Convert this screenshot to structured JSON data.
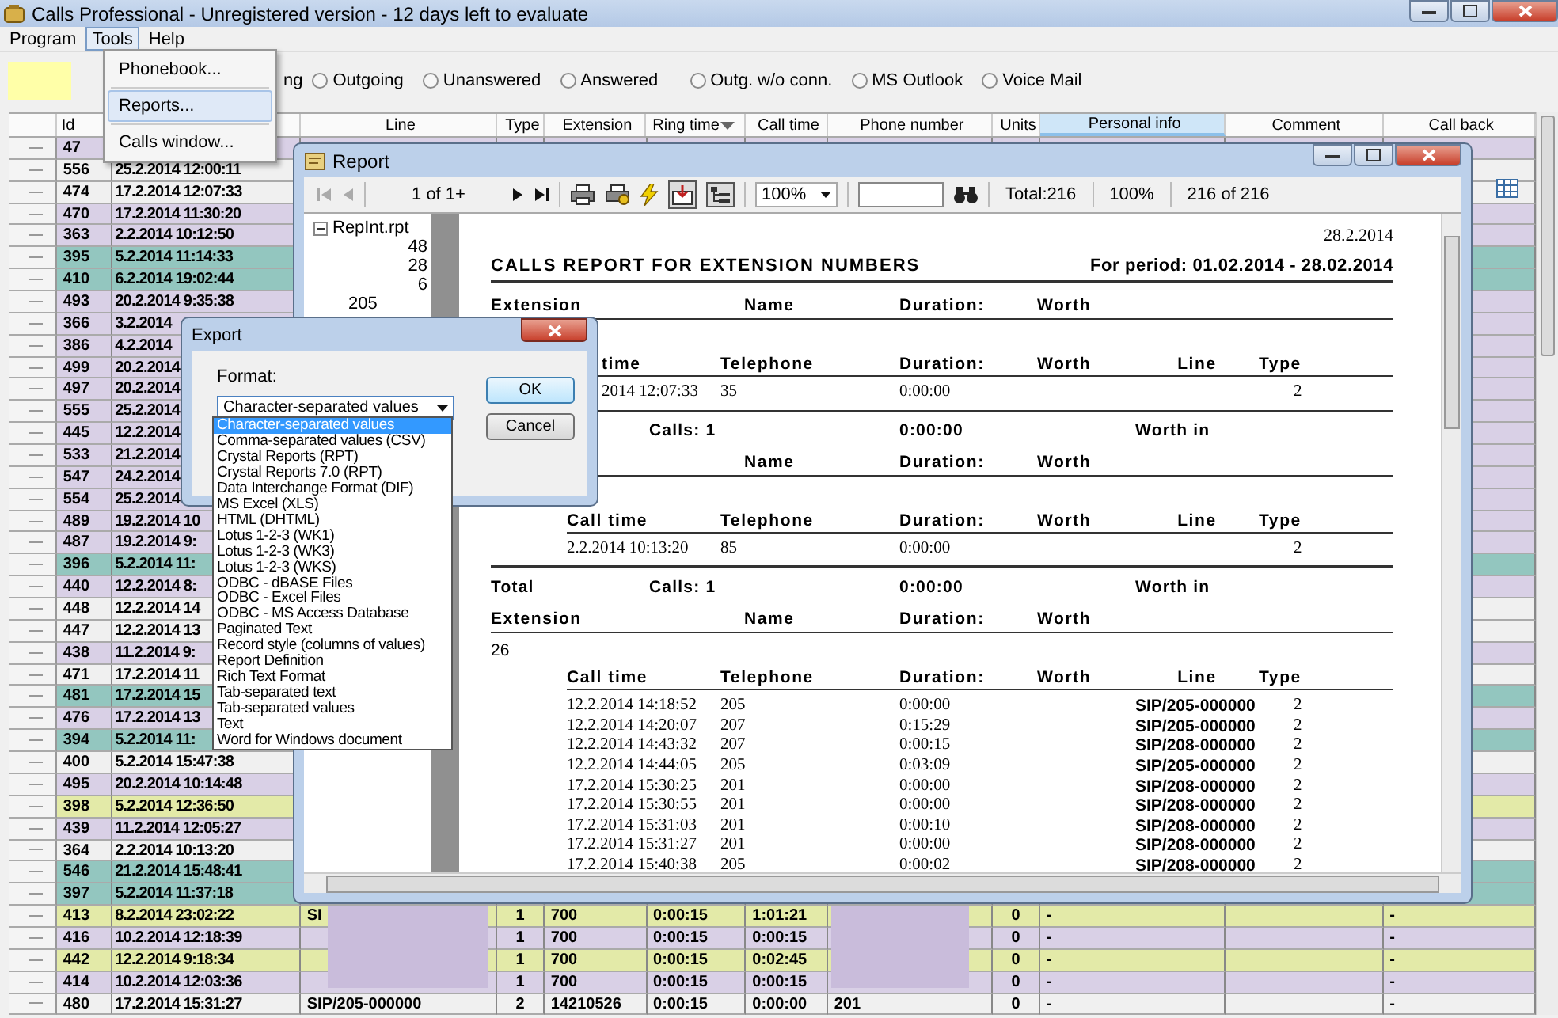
{
  "window": {
    "title": "Calls Professional - Unregistered version - 12 days left to evaluate"
  },
  "menu": [
    {
      "label": "Program",
      "selected": false
    },
    {
      "label": "Tools",
      "selected": true
    },
    {
      "label": "Help",
      "selected": false
    }
  ],
  "tools_menu": [
    {
      "label": "Phonebook...",
      "selected": false
    },
    {
      "label": "Reports...",
      "selected": true
    },
    {
      "label": "Calls window...",
      "selected": false
    }
  ],
  "filters": {
    "cut_label": "ng",
    "options": [
      {
        "label": "Outgoing",
        "selected": false
      },
      {
        "label": "Unanswered",
        "selected": false
      },
      {
        "label": "Answered",
        "selected": false
      },
      {
        "label": "Outg. w/o conn.",
        "selected": false
      },
      {
        "label": "MS Outlook",
        "selected": false
      },
      {
        "label": "Voice Mail",
        "selected": false
      }
    ]
  },
  "table": {
    "columns": [
      {
        "label": "Id",
        "selected": false,
        "sorted": false
      },
      {
        "label": "Line",
        "selected": false,
        "sorted": false
      },
      {
        "label": "Type",
        "selected": false,
        "sorted": false
      },
      {
        "label": "Extension",
        "selected": false,
        "sorted": false
      },
      {
        "label": "Ring time",
        "selected": false,
        "sorted": true
      },
      {
        "label": "Call time",
        "selected": false,
        "sorted": false
      },
      {
        "label": "Phone number",
        "selected": false,
        "sorted": false
      },
      {
        "label": "Units",
        "selected": false,
        "sorted": false
      },
      {
        "label": "Personal info",
        "selected": true,
        "sorted": false
      },
      {
        "label": "Comment",
        "selected": false,
        "sorted": false
      },
      {
        "label": "Call back",
        "selected": false,
        "sorted": false
      }
    ],
    "rows": [
      {
        "id": "47",
        "color": "#d9d0e6"
      },
      {
        "id": "556",
        "time": "25.2.2014 12:00:11",
        "color": "#f0f0f0"
      },
      {
        "id": "474",
        "time": "17.2.2014 12:07:33",
        "color": "#f0f0f0"
      },
      {
        "id": "470",
        "time": "17.2.2014 11:30:20",
        "color": "#d9d0e6"
      },
      {
        "id": "363",
        "time": "2.2.2014 10:12:50",
        "color": "#d9d0e6"
      },
      {
        "id": "395",
        "time": "5.2.2014 11:14:33",
        "color": "#93c6bf"
      },
      {
        "id": "410",
        "time": "6.2.2014 19:02:44",
        "color": "#93c6bf"
      },
      {
        "id": "493",
        "time": "20.2.2014 9:35:38",
        "color": "#d9d0e6"
      },
      {
        "id": "366",
        "time": "3.2.2014",
        "color": "#d9d0e6"
      },
      {
        "id": "386",
        "time": "4.2.2014",
        "color": "#d9d0e6"
      },
      {
        "id": "499",
        "time": "20.2.2014",
        "color": "#d9d0e6"
      },
      {
        "id": "497",
        "time": "20.2.2014",
        "color": "#d9d0e6"
      },
      {
        "id": "555",
        "time": "25.2.2014",
        "color": "#d9d0e6"
      },
      {
        "id": "445",
        "time": "12.2.2014",
        "color": "#d9d0e6"
      },
      {
        "id": "533",
        "time": "21.2.2014",
        "color": "#d9d0e6"
      },
      {
        "id": "547",
        "time": "24.2.2014",
        "color": "#d9d0e6"
      },
      {
        "id": "554",
        "time": "25.2.2014",
        "color": "#d9d0e6"
      },
      {
        "id": "489",
        "time": "19.2.2014 10",
        "color": "#d9d0e6"
      },
      {
        "id": "487",
        "time": "19.2.2014 9:",
        "color": "#d9d0e6"
      },
      {
        "id": "396",
        "time": "5.2.2014 11:",
        "color": "#93c6bf"
      },
      {
        "id": "440",
        "time": "12.2.2014 8:",
        "color": "#d9d0e6"
      },
      {
        "id": "448",
        "time": "12.2.2014 14",
        "color": "#f0f0f0"
      },
      {
        "id": "447",
        "time": "12.2.2014 13",
        "color": "#f0f0f0"
      },
      {
        "id": "438",
        "time": "11.2.2014 9:",
        "color": "#d9d0e6"
      },
      {
        "id": "471",
        "time": "17.2.2014 11",
        "color": "#f0f0f0"
      },
      {
        "id": "481",
        "time": "17.2.2014 15",
        "color": "#93c6bf"
      },
      {
        "id": "476",
        "time": "17.2.2014 13",
        "color": "#d9d0e6"
      },
      {
        "id": "394",
        "time": "5.2.2014 11:",
        "color": "#93c6bf"
      },
      {
        "id": "400",
        "time": "5.2.2014 15:47:38",
        "color": "#f0f0f0"
      },
      {
        "id": "495",
        "time": "20.2.2014 10:14:48",
        "color": "#d9d0e6"
      },
      {
        "id": "398",
        "time": "5.2.2014 12:36:50",
        "color": "#e3eaa8"
      },
      {
        "id": "439",
        "time": "11.2.2014 12:05:27",
        "color": "#d9d0e6"
      },
      {
        "id": "364",
        "time": "2.2.2014 10:13:20",
        "color": "#f0f0f0"
      },
      {
        "id": "546",
        "time": "21.2.2014 15:48:41",
        "color": "#93c6bf"
      },
      {
        "id": "397",
        "time": "5.2.2014 11:37:18",
        "color": "#93c6bf"
      },
      {
        "id": "413",
        "time": "8.2.2014 23:02:22",
        "color": "#e3eaa8",
        "line": "SI",
        "type": "1",
        "extension": "700",
        "ring_time": "0:00:15",
        "call_time": "1:01:21",
        "units": "0",
        "personal_info": "-",
        "call_back": "-"
      },
      {
        "id": "416",
        "time": "10.2.2014 12:18:39",
        "color": "#d9d0e6",
        "type": "1",
        "extension": "700",
        "ring_time": "0:00:15",
        "call_time": "0:00:15",
        "units": "0",
        "personal_info": "-",
        "call_back": "-"
      },
      {
        "id": "442",
        "time": "12.2.2014 9:18:34",
        "color": "#e3eaa8",
        "type": "1",
        "extension": "700",
        "ring_time": "0:00:15",
        "call_time": "0:02:45",
        "units": "0",
        "personal_info": "-",
        "call_back": "-"
      },
      {
        "id": "414",
        "time": "10.2.2014 12:03:36",
        "color": "#d9d0e6",
        "type": "1",
        "extension": "700",
        "ring_time": "0:00:15",
        "call_time": "0:00:15",
        "units": "0",
        "personal_info": "-",
        "call_back": "-"
      },
      {
        "id": "480",
        "time": "17.2.2014 15:31:27",
        "color": "#f0f0f0",
        "line": "SIP/205-000000",
        "type": "2",
        "extension": "14210526",
        "ring_time": "0:00:15",
        "call_time": "0:00:00",
        "phone": "201",
        "units": "0",
        "personal_info": "-",
        "call_back": "-"
      }
    ]
  },
  "report": {
    "title": "Report",
    "page_status": "1 of 1+",
    "zoom": "100%",
    "total": "Total:216",
    "zoom_status": "100%",
    "count": "216 of 216",
    "export_pressed": true,
    "tree_pressed": true,
    "tree": {
      "root": "RepInt.rpt",
      "expanded": true,
      "values": [
        "48",
        "28",
        "6"
      ],
      "child": "205"
    },
    "lines": [
      {
        "kind": "date",
        "text": "28.2.2014"
      },
      {
        "kind": "title",
        "text": "CALLS REPORT FOR EXTENSION NUMBERS",
        "period": "For period: 01.02.2014 - 28.02.2014"
      },
      {
        "kind": "group_header",
        "extension": "Extension",
        "name": "Name",
        "duration": "Duration:",
        "worth": "Worth"
      },
      {
        "kind": "call_header",
        "covered_left": true,
        "call_time": "time",
        "telephone": "Telephone",
        "duration": "Duration:",
        "worth": "Worth",
        "line": "Line",
        "type": "Type"
      },
      {
        "kind": "call_row",
        "covered_left": true,
        "call_time": "2014  12:07:33",
        "telephone": "35",
        "duration": "0:00:00",
        "type": "2"
      },
      {
        "kind": "summary",
        "calls": "Calls: 1",
        "duration": "0:00:00",
        "worth": "Worth in"
      },
      {
        "kind": "group_header",
        "name": "Name",
        "duration": "Duration:",
        "worth": "Worth"
      },
      {
        "kind": "call_header",
        "call_time": "Call time",
        "telephone": "Telephone",
        "duration": "Duration:",
        "worth": "Worth",
        "line": "Line",
        "type": "Type"
      },
      {
        "kind": "call_row",
        "call_time": "2.2.2014  10:13:20",
        "telephone": "85",
        "duration": "0:00:00",
        "type": "2"
      },
      {
        "kind": "total",
        "label": "Total",
        "calls": "Calls: 1",
        "duration": "0:00:00",
        "worth": "Worth in"
      },
      {
        "kind": "group_header",
        "extension": "Extension",
        "name": "Name",
        "duration": "Duration:",
        "worth": "Worth"
      },
      {
        "kind": "extension_value",
        "text": "26"
      },
      {
        "kind": "call_header",
        "call_time": "Call time",
        "telephone": "Telephone",
        "duration": "Duration:",
        "worth": "Worth",
        "line": "Line",
        "type": "Type"
      },
      {
        "kind": "call_row",
        "call_time": "12.2.2014  14:18:52",
        "telephone": "205",
        "duration": "0:00:00",
        "line": "SIP/205-000000",
        "type": "2"
      },
      {
        "kind": "call_row",
        "call_time": "12.2.2014  14:20:07",
        "telephone": "207",
        "duration": "0:15:29",
        "line": "SIP/205-000000",
        "type": "2"
      },
      {
        "kind": "call_row",
        "call_time": "12.2.2014  14:43:32",
        "telephone": "207",
        "duration": "0:00:15",
        "line": "SIP/208-000000",
        "type": "2"
      },
      {
        "kind": "call_row",
        "call_time": "12.2.2014  14:44:05",
        "telephone": "205",
        "duration": "0:03:09",
        "line": "SIP/205-000000",
        "type": "2"
      },
      {
        "kind": "call_row",
        "call_time": "17.2.2014  15:30:25",
        "telephone": "201",
        "duration": "0:00:00",
        "line": "SIP/208-000000",
        "type": "2"
      },
      {
        "kind": "call_row",
        "call_time": "17.2.2014  15:30:55",
        "telephone": "201",
        "duration": "0:00:00",
        "line": "SIP/208-000000",
        "type": "2"
      },
      {
        "kind": "call_row",
        "call_time": "17.2.2014  15:31:03",
        "telephone": "201",
        "duration": "0:00:10",
        "line": "SIP/208-000000",
        "type": "2"
      },
      {
        "kind": "call_row",
        "call_time": "17.2.2014  15:31:27",
        "telephone": "201",
        "duration": "0:00:00",
        "line": "SIP/208-000000",
        "type": "2"
      },
      {
        "kind": "call_row",
        "call_time": "17.2.2014  15:40:38",
        "telephone": "205",
        "duration": "0:00:02",
        "line": "SIP/208-000000",
        "type": "2"
      }
    ]
  },
  "export_dialog": {
    "title": "Export",
    "format_label": "Format:",
    "format_value": "Character-separated values",
    "expanded": true,
    "options": [
      {
        "label": "Character-separated values",
        "selected": true
      },
      {
        "label": "Comma-separated values (CSV)",
        "selected": false
      },
      {
        "label": "Crystal Reports (RPT)",
        "selected": false
      },
      {
        "label": "Crystal Reports 7.0 (RPT)",
        "selected": false
      },
      {
        "label": "Data Interchange Format (DIF)",
        "selected": false
      },
      {
        "label": "MS Excel (XLS)",
        "selected": false
      },
      {
        "label": "HTML (DHTML)",
        "selected": false
      },
      {
        "label": "Lotus 1-2-3 (WK1)",
        "selected": false
      },
      {
        "label": "Lotus 1-2-3 (WK3)",
        "selected": false
      },
      {
        "label": "Lotus 1-2-3 (WKS)",
        "selected": false
      },
      {
        "label": "ODBC - dBASE Files",
        "selected": false
      },
      {
        "label": "ODBC - Excel Files",
        "selected": false
      },
      {
        "label": "ODBC - MS Access Database",
        "selected": false
      },
      {
        "label": "Paginated Text",
        "selected": false
      },
      {
        "label": "Record style (columns of values)",
        "selected": false
      },
      {
        "label": "Report Definition",
        "selected": false
      },
      {
        "label": "Rich Text Format",
        "selected": false
      },
      {
        "label": "Tab-separated text",
        "selected": false
      },
      {
        "label": "Tab-separated values",
        "selected": false
      },
      {
        "label": "Text",
        "selected": false
      },
      {
        "label": "Word for Windows document",
        "selected": false
      }
    ],
    "buttons": [
      "OK",
      "Cancel"
    ]
  }
}
